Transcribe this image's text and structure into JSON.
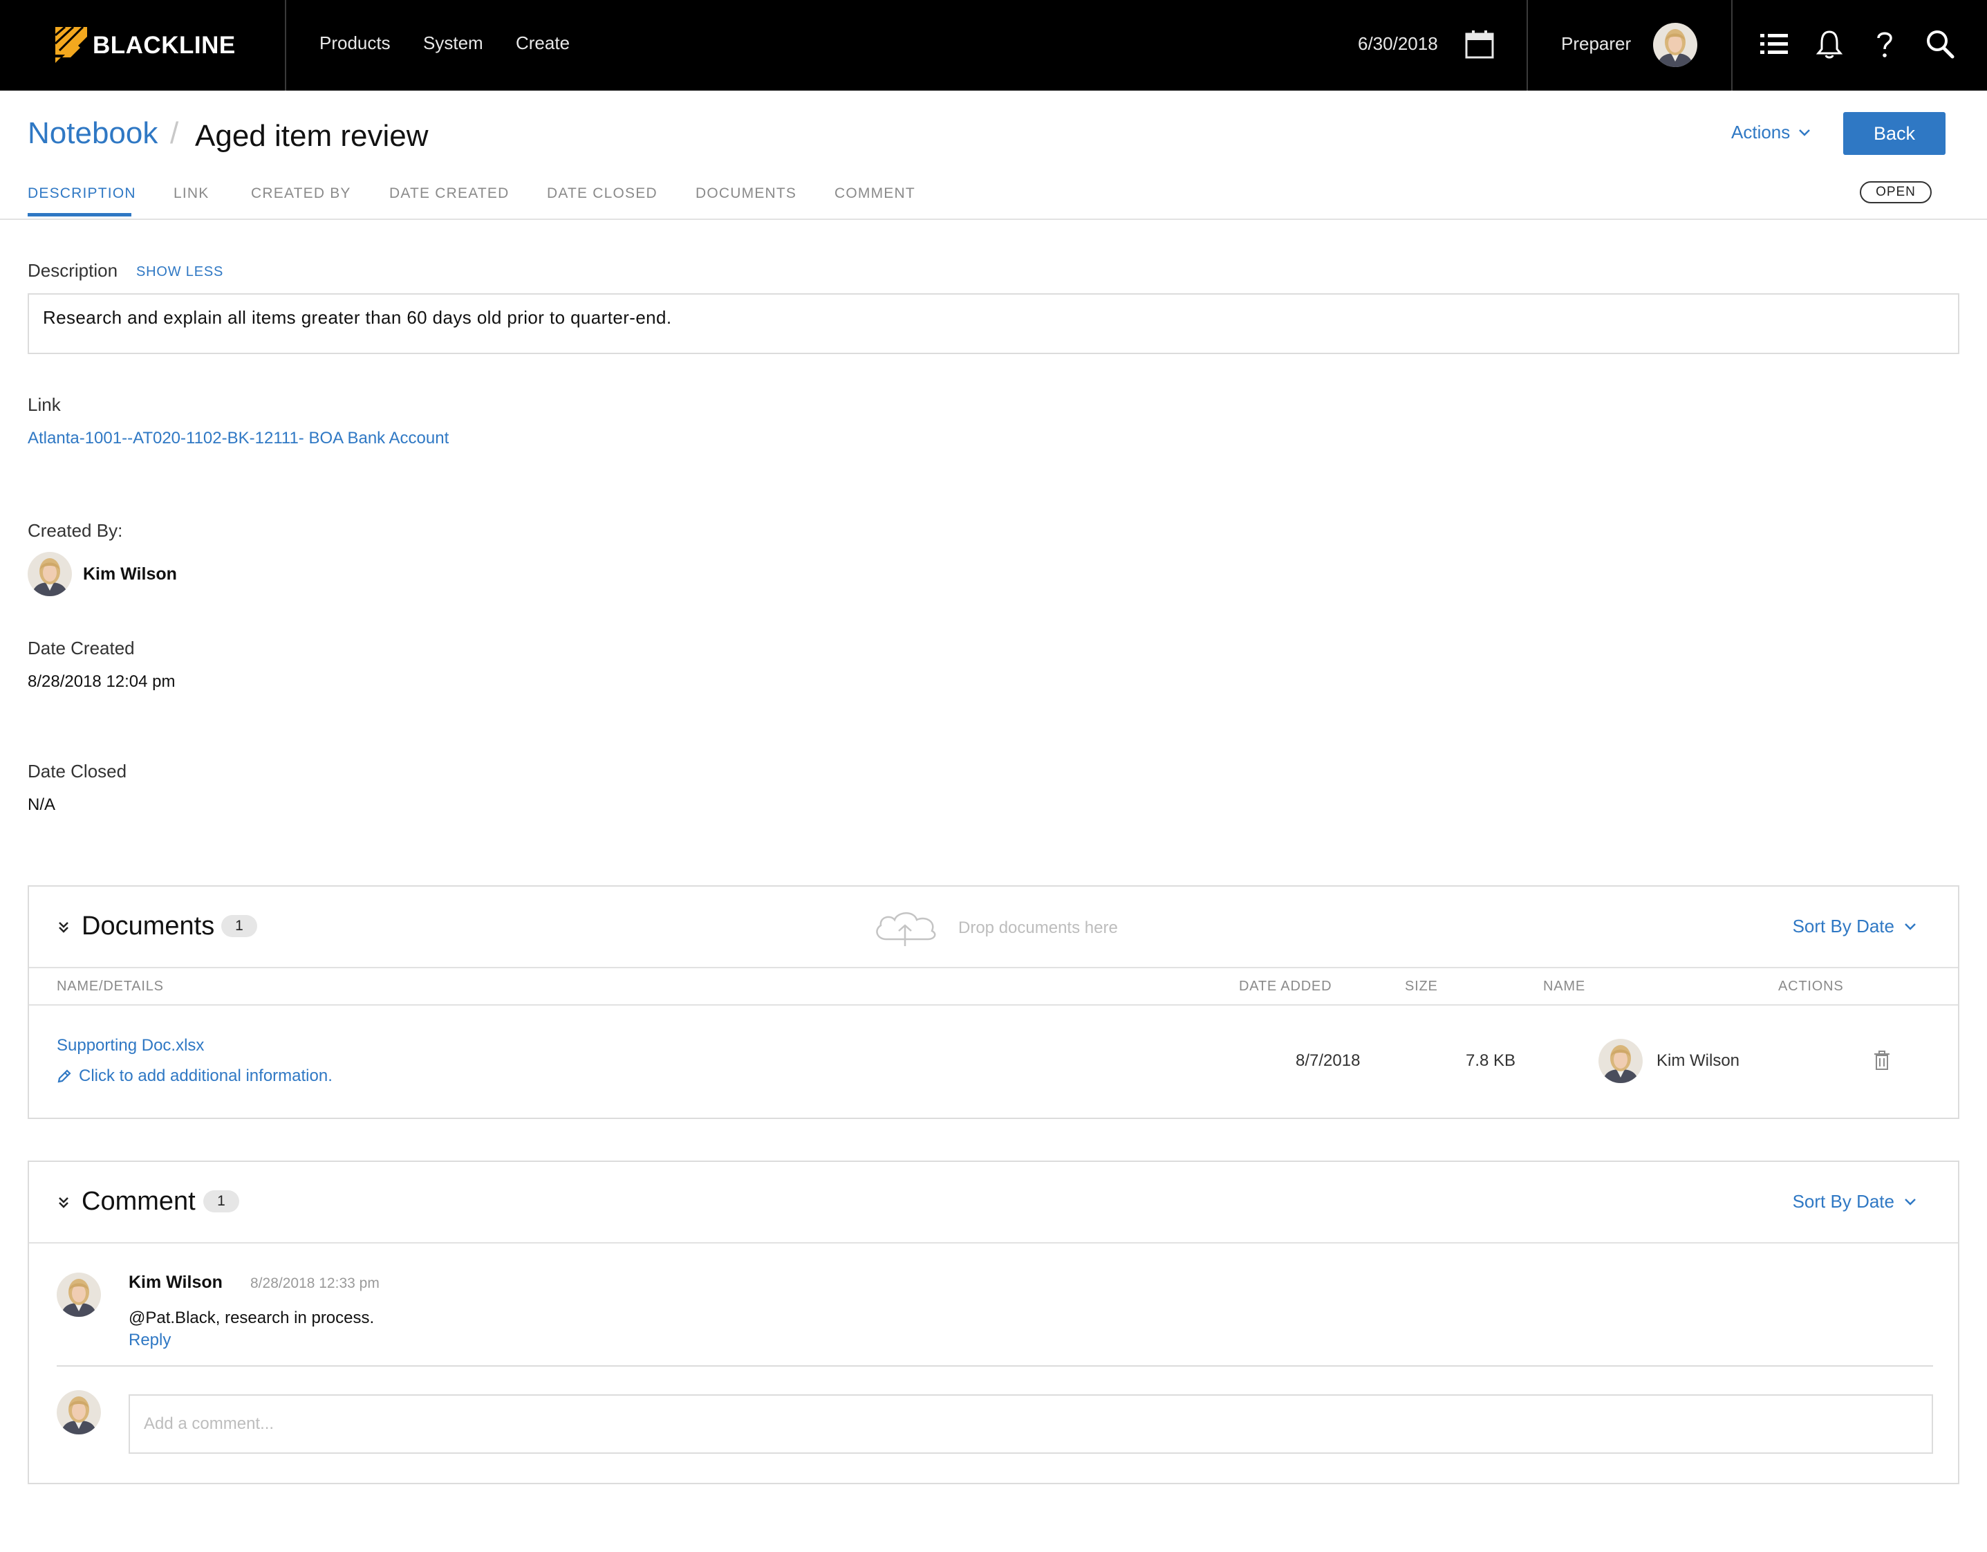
{
  "brand": {
    "name": "BLACKLINE",
    "accent": "#f3a81e",
    "link_color": "#2f78c4"
  },
  "nav": {
    "products": "Products",
    "system": "System",
    "create": "Create"
  },
  "period_date": "6/30/2018",
  "role": "Preparer",
  "icons": {
    "calendar": "calendar-icon",
    "list": "list-icon",
    "bell": "bell-icon",
    "help": "help-icon",
    "search": "search-icon"
  },
  "breadcrumb": {
    "root": "Notebook",
    "separator": "/",
    "title": "Aged item review"
  },
  "header": {
    "actions_label": "Actions",
    "back_label": "Back"
  },
  "tabs": [
    "DESCRIPTION",
    "LINK",
    "CREATED BY",
    "DATE CREATED",
    "DATE CLOSED",
    "DOCUMENTS",
    "COMMENT"
  ],
  "status": "OPEN",
  "description": {
    "label": "Description",
    "toggle": "SHOW LESS",
    "text": "Research and explain all items greater than 60 days old prior to quarter-end."
  },
  "link": {
    "label": "Link",
    "value": "Atlanta-1001--AT020-1102-BK-12111- BOA Bank Account"
  },
  "created_by": {
    "label": "Created By:",
    "name": "Kim Wilson"
  },
  "date_created": {
    "label": "Date Created",
    "value": "8/28/2018 12:04 pm"
  },
  "date_closed": {
    "label": "Date Closed",
    "value": "N/A"
  },
  "documents": {
    "title": "Documents",
    "count": "1",
    "drop_text": "Drop documents here",
    "sort_label": "Sort By Date",
    "columns": [
      "NAME/DETAILS",
      "DATE ADDED",
      "SIZE",
      "NAME",
      "ACTIONS"
    ],
    "rows": [
      {
        "file_name": "Supporting Doc.xlsx",
        "details_prompt": "Click to add additional information.",
        "date_added": "8/7/2018",
        "size": "7.8 KB",
        "owner": "Kim Wilson"
      }
    ]
  },
  "comments": {
    "title": "Comment",
    "count": "1",
    "sort_label": "Sort By Date",
    "items": [
      {
        "author": "Kim Wilson",
        "timestamp": "8/28/2018 12:33 pm",
        "text": "@Pat.Black, research in process.",
        "reply_label": "Reply"
      }
    ],
    "input_placeholder": "Add a comment..."
  }
}
